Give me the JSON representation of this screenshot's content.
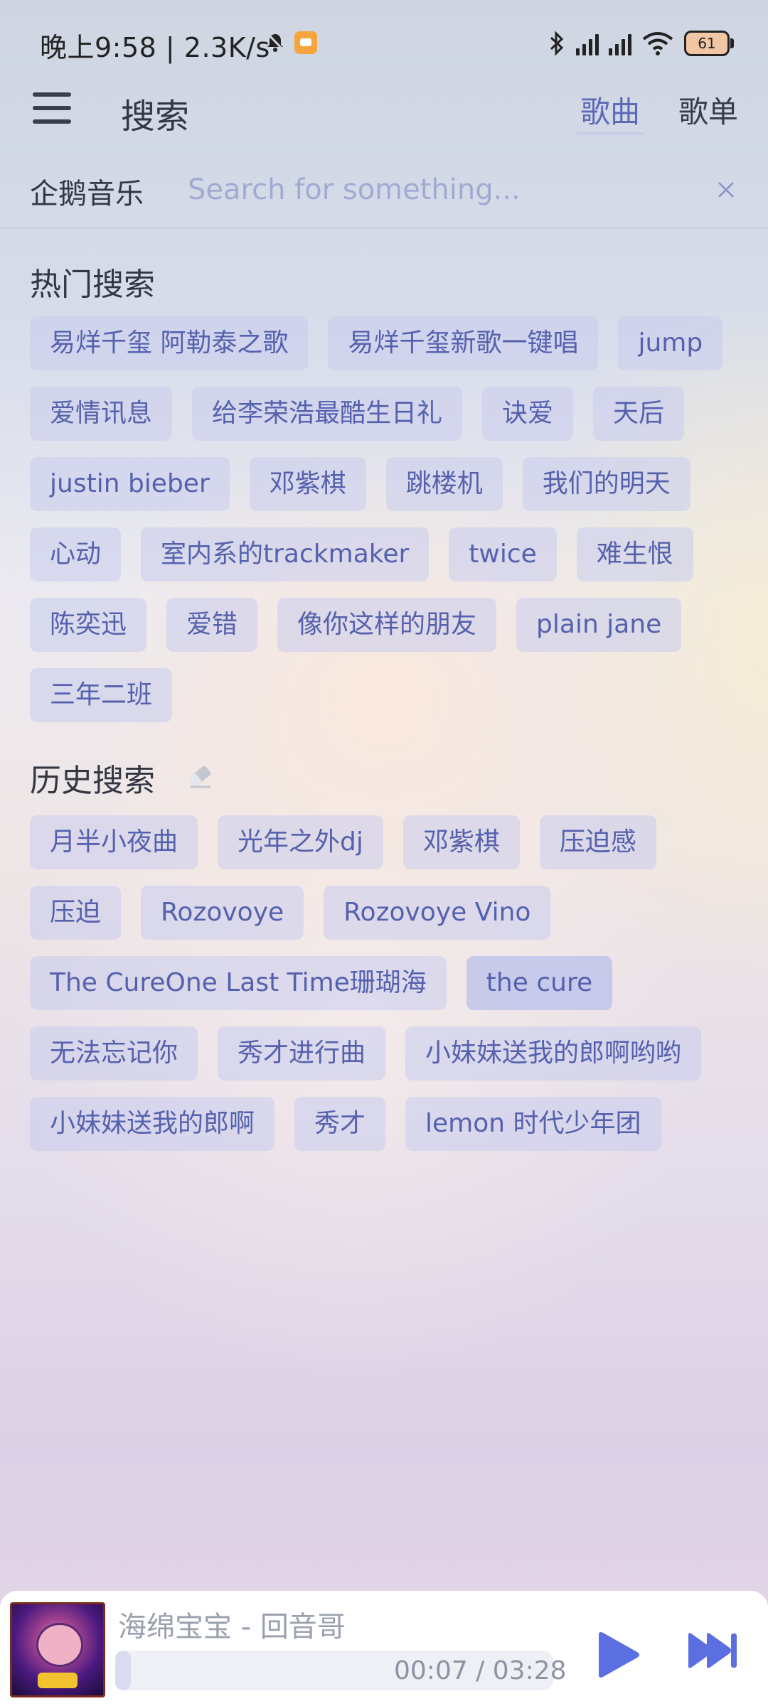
{
  "status_bar": {
    "time": "晚上9:58 | 2.3K/s",
    "battery": "61",
    "icons": [
      "mute-bell-icon",
      "app-notification-icon",
      "bluetooth-icon",
      "signal-icon",
      "signal-icon",
      "wifi-icon",
      "battery-icon"
    ]
  },
  "header": {
    "title": "搜索",
    "tabs": [
      {
        "label": "歌曲",
        "active": true
      },
      {
        "label": "歌单",
        "active": false
      }
    ]
  },
  "search": {
    "source": "企鹅音乐",
    "placeholder": "Search for something...",
    "value": ""
  },
  "hot": {
    "title": "热门搜索",
    "items": [
      "易烊千玺 阿勒泰之歌",
      "易烊千玺新歌一键唱",
      "jump",
      "爱情讯息",
      "给李荣浩最酷生日礼",
      "诀爱",
      "天后",
      "justin bieber",
      "邓紫棋",
      "跳楼机",
      "我们的明天",
      "心动",
      "室内系的trackmaker",
      "twice",
      "难生恨",
      "陈奕迅",
      "爱错",
      "像你这样的朋友",
      "plain jane",
      "三年二班"
    ]
  },
  "history": {
    "title": "历史搜索",
    "items": [
      "月半小夜曲",
      "光年之外dj",
      "邓紫棋",
      "压迫感",
      "压迫",
      "Rozovoye",
      "Rozovoye Vino",
      "The CureOne Last Time珊瑚海",
      "the cure",
      "无法忘记你",
      "秀才进行曲",
      "小妹妹送我的郎啊哟哟",
      "小妹妹送我的郎啊",
      "秀才",
      "lemon 时代少年团"
    ],
    "highlighted_index": 8
  },
  "player": {
    "song": "海绵宝宝 - 回音哥",
    "time": "00:07 / 03:28",
    "progress": 0.035,
    "accent": "#5b6fe0"
  }
}
